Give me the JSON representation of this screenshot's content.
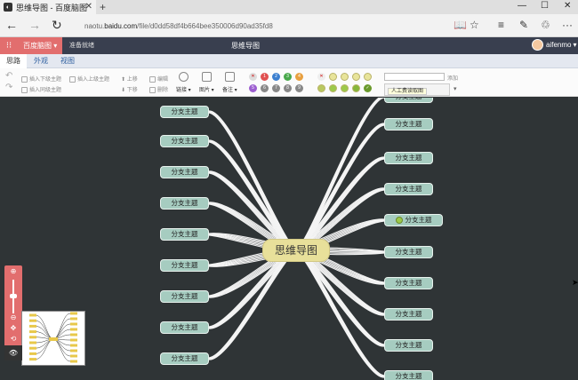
{
  "browser": {
    "tab_title": "思维导图 - 百度脑图",
    "tab_close": "✕",
    "new_tab": "+",
    "url_prefix": "naotu.",
    "url_domain": "baidu.com",
    "url_path": "/file/d0dd58df4b664bee350006d90ad35fd8",
    "win_min": "—",
    "win_max": "☐",
    "win_close": "✕",
    "icons": {
      "back": "←",
      "forward": "→",
      "refresh": "↻",
      "reading": "📖",
      "star": "☆",
      "hub": "≡",
      "note": "✎",
      "share": "♲",
      "more": "···"
    }
  },
  "app": {
    "brand": "百度脑图 ▾",
    "status": "准备就绪",
    "title": "思维导图",
    "user": "aifenmo",
    "user_caret": "▾",
    "grid_icon": "⁝⁝"
  },
  "menu_tabs": [
    "思路",
    "外观",
    "视图"
  ],
  "toolbar": {
    "insert_child": "插入下级主题",
    "insert_parent": "插入上级主题",
    "insert_sibling": "插入同级主题",
    "up": "上移",
    "down": "下移",
    "edit": "编辑",
    "delete": "删除",
    "link": "链接 ▾",
    "image": "图片 ▾",
    "note": "备注 ▾",
    "priorities": [
      "1",
      "2",
      "3",
      "4",
      "5",
      "6",
      "7",
      "8",
      "9"
    ],
    "tag_add": "添加",
    "tag_suggestion": "人工费读取图",
    "tag_caret": "▾",
    "cancel_priority": "✕",
    "cancel_progress": "✕",
    "progress_done": "✓"
  },
  "colors": {
    "accent": "#e26e6e",
    "header": "#393f4f",
    "canvas": "#2f3436",
    "node": "#a6ccc0",
    "root": "#e8e09a"
  },
  "mindmap": {
    "root": "思维导图",
    "left_nodes": [
      "分支主题",
      "分支主题",
      "分支主题",
      "分支主题",
      "分支主题",
      "分支主题",
      "分支主题",
      "分支主题",
      "分支主题"
    ],
    "right_nodes": [
      "分支主题",
      "分支主题",
      "分支主题",
      "分支主题",
      "分支主题",
      "分支主题",
      "分支主题",
      "分支主题",
      "分支主题",
      "分支主题"
    ]
  },
  "zoom_tools": {
    "zoom_in": "⊕",
    "zoom_out": "⊖",
    "move": "✥",
    "locate": "⟲",
    "eye": "👁"
  }
}
